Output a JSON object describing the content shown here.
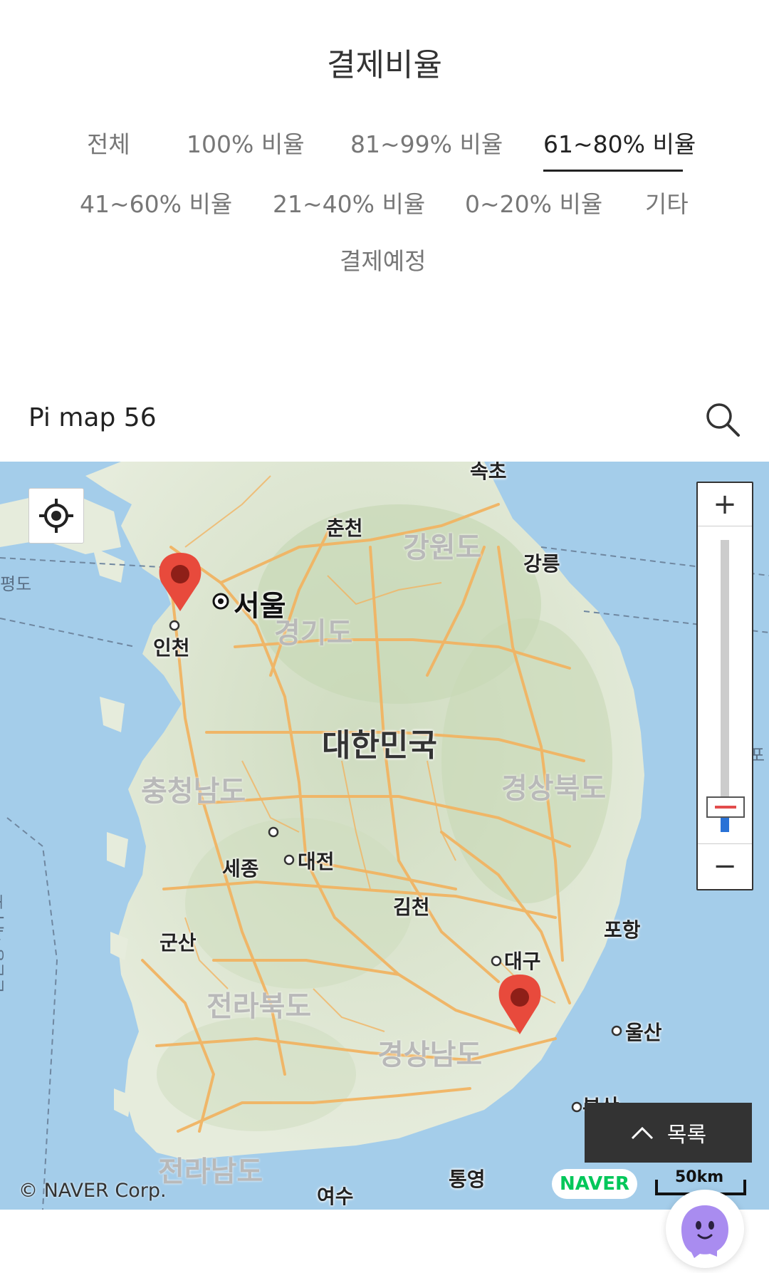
{
  "page": {
    "title": "결제비율"
  },
  "tabs": [
    {
      "label": "전체",
      "active": false
    },
    {
      "label": "100% 비율",
      "active": false
    },
    {
      "label": "81~99% 비율",
      "active": false
    },
    {
      "label": "61~80% 비율",
      "active": true
    },
    {
      "label": "41~60% 비율",
      "active": false
    },
    {
      "label": "21~40% 비율",
      "active": false
    },
    {
      "label": "0~20% 비율",
      "active": false
    },
    {
      "label": "기타",
      "active": false
    },
    {
      "label": "결제예정",
      "active": false
    }
  ],
  "search": {
    "title": "Pi map 56",
    "icon": "search-icon"
  },
  "map": {
    "capital": "서울",
    "country": "대한민국",
    "cities": [
      "인천",
      "춘천",
      "강릉",
      "세종",
      "대전",
      "김천",
      "군산",
      "대구",
      "포항",
      "울산",
      "통영",
      "여수",
      "속초",
      "부산"
    ],
    "provinces": [
      "강원도",
      "경기도",
      "충청남도",
      "경상북도",
      "전라북도",
      "경상남도",
      "전라남도"
    ],
    "routes": [
      "평도",
      "인천항-제주도",
      "포"
    ],
    "markers": [
      {
        "name": "marker-incheon",
        "color": "#e84a3c"
      },
      {
        "name": "marker-daegu",
        "color": "#e84a3c"
      }
    ],
    "zoom": {
      "plus": "+",
      "minus": "−",
      "level": 0.06
    },
    "copyright": "© NAVER Corp.",
    "brand": "NAVER",
    "scale": "50km"
  },
  "list_button": {
    "label": "목록",
    "icon": "chevron-up-icon"
  },
  "chatbot": {
    "icon": "chatbot-ghost-icon"
  },
  "colors": {
    "accent_underline": "#222222",
    "marker": "#e84a3c",
    "sea": "#a4cdea",
    "land": "#e8eddd",
    "road": "#f3b96a",
    "naver": "#03c75a"
  }
}
